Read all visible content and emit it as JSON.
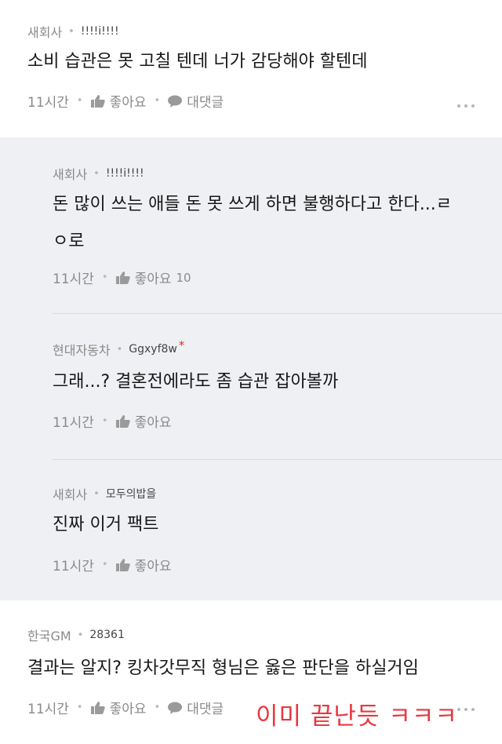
{
  "comments": [
    {
      "company": "새회사",
      "nickname": "!!!!i!!!!",
      "text_lines": [
        "소비 습관은 못 고칠 텐데 너가 감당해야 할텐데"
      ],
      "time": "11시간",
      "like_label": "좋아요",
      "like_count": "",
      "reply_label": "대댓글"
    },
    {
      "company": "새회사",
      "nickname": "!!!!i!!!!",
      "text_lines": [
        "돈 많이 쓰는 애들 돈 못 쓰게 하면 불행하다고 한다...ㄹ",
        "ㅇ로"
      ],
      "time": "11시간",
      "like_label": "좋아요",
      "like_count": "10"
    },
    {
      "company": "현대자동차",
      "nickname": "Ggxyf8w",
      "star": "*",
      "text_lines": [
        "그래...? 결혼전에라도 좀 습관 잡아볼까"
      ],
      "time": "11시간",
      "like_label": "좋아요"
    },
    {
      "company": "새회사",
      "nickname": "모두의밥을",
      "text_lines": [
        "진짜 이거 팩트"
      ],
      "time": "11시간",
      "like_label": "좋아요"
    },
    {
      "company": "한국GM",
      "nickname": "28361",
      "text_lines": [
        "결과는 알지? 킹차갓무직 형님은 옳은 판단을 하실거임"
      ],
      "time": "11시간",
      "like_label": "좋아요",
      "reply_label": "대댓글"
    }
  ],
  "overlay_text": "이미 끝난듯 ㅋㅋㅋ",
  "colors": {
    "reply_bg": "#eff0f3",
    "overlay": "#e8383f",
    "meta": "#8a8a8a"
  },
  "icons": {
    "like": "thumbs-up-icon",
    "reply": "speech-bubble-icon",
    "more": "more-dots-icon"
  }
}
